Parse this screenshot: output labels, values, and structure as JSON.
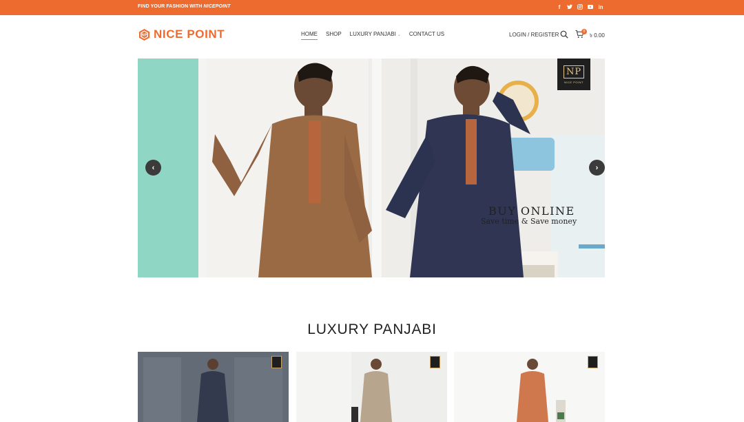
{
  "topbar": {
    "tagline_prefix": "FIND YOUR FASHION WITH ",
    "tagline_brand": "NICEPOINT",
    "socials": [
      "facebook-icon",
      "twitter-icon",
      "instagram-icon",
      "youtube-icon",
      "linkedin-icon"
    ]
  },
  "header": {
    "logo_text": "NICE POINT",
    "nav": [
      "HOME",
      "SHOP",
      "LUXURY PANJABI",
      "CONTACT US"
    ],
    "login_label": "LOGIN / REGISTER",
    "cart_count": "0",
    "cart_total": "৳ 0.00"
  },
  "slider": {
    "title": "BUY ONLINE",
    "subtitle": "Save time & Save money",
    "badge_text": "NP",
    "badge_caption": "NICE POINT"
  },
  "section": {
    "title": "LUXURY PANJABI"
  },
  "colors": {
    "accent": "#ee6b2f"
  }
}
